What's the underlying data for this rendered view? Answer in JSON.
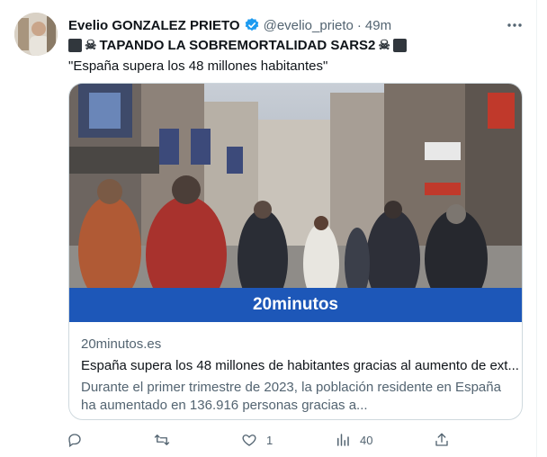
{
  "tweet": {
    "author_name": "Evelio GONZALEZ PRIETO",
    "handle": "@evelio_prieto",
    "separator": "·",
    "time": "49m",
    "line1_text": "TAPANDO LA SOBREMORTALIDAD SARS2",
    "line2_text": "\"España supera los 48 millones habitantes\"",
    "more_icon": "more-icon",
    "verified_color": "#1d9bf0"
  },
  "card": {
    "brand_text": "20minutos",
    "brand_color": "#1d57b8",
    "domain": "20minutos.es",
    "title": "España supera los 48 millones de habitantes gracias al aumento de ext...",
    "description": "Durante el primer trimestre de 2023, la población residente en España ha aumentado en 136.916 personas gracias a..."
  },
  "actions": {
    "reply_count": "",
    "retweet_count": "",
    "like_count": "1",
    "views_count": "40"
  }
}
